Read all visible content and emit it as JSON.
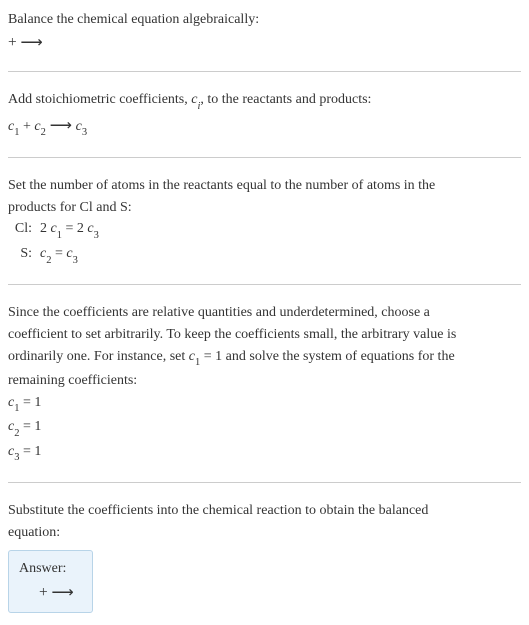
{
  "intro": {
    "line1": "Balance the chemical equation algebraically:",
    "line2": " + ⟶"
  },
  "step1": {
    "text": "Add stoichiometric coefficients, c_i, to the reactants and products:",
    "eq_c1": "c",
    "eq_s1": "1",
    "eq_plus": " + ",
    "eq_c2": "c",
    "eq_s2": "2",
    "eq_arrow": " ⟶ ",
    "eq_c3": "c",
    "eq_s3": "3"
  },
  "step2": {
    "text1": "Set the number of atoms in the reactants equal to the number of atoms in the",
    "text2": "products for Cl and S:",
    "cl_label": "Cl:",
    "cl_eq_part1": "2 ",
    "cl_eq_c1": "c",
    "cl_eq_s1": "1",
    "cl_eq_mid": " = 2 ",
    "cl_eq_c3": "c",
    "cl_eq_s3": "3",
    "s_label": "S:",
    "s_eq_c2": "c",
    "s_eq_s2": "2",
    "s_eq_mid": " = ",
    "s_eq_c3": "c",
    "s_eq_s3": "3"
  },
  "step3": {
    "text1": "Since the coefficients are relative quantities and underdetermined, choose a",
    "text2": "coefficient to set arbitrarily. To keep the coefficients small, the arbitrary value is",
    "text3": "ordinarily one. For instance, set c_1 = 1 and solve the system of equations for the",
    "text4": "remaining coefficients:",
    "r1_c": "c",
    "r1_s": "1",
    "r1_rest": " = 1",
    "r2_c": "c",
    "r2_s": "2",
    "r2_rest": " = 1",
    "r3_c": "c",
    "r3_s": "3",
    "r3_rest": " = 1"
  },
  "step4": {
    "text1": "Substitute the coefficients into the chemical reaction to obtain the balanced",
    "text2": "equation:"
  },
  "answer": {
    "title": "Answer:",
    "eq": " + ⟶"
  }
}
